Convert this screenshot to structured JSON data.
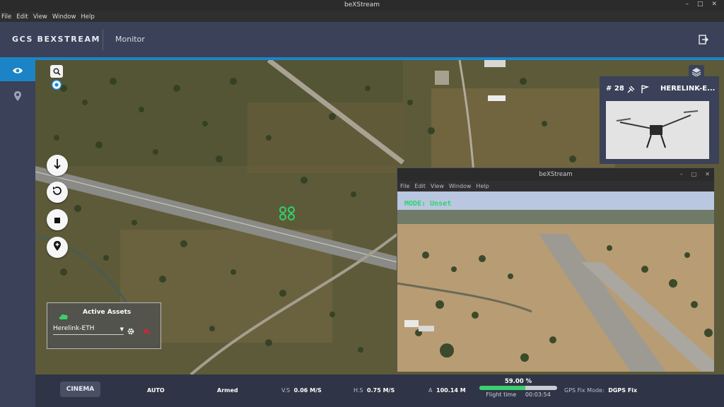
{
  "window": {
    "title": "beXStream",
    "controls": [
      "–",
      "□",
      "✕"
    ],
    "menu": [
      "File",
      "Edit",
      "View",
      "Window",
      "Help"
    ]
  },
  "header": {
    "brand": "GCS BEXSTREAM",
    "section": "Monitor",
    "logout_icon": "logout-icon"
  },
  "sidebar": {
    "items": [
      {
        "icon": "eye-icon",
        "active": true
      },
      {
        "icon": "location-pin-icon",
        "active": false
      }
    ]
  },
  "map_controls": {
    "small": [
      "search-icon",
      "target-icon"
    ],
    "round": [
      "arrow-down-icon",
      "rotate-icon",
      "stop-icon",
      "add-waypoint-icon"
    ],
    "layers_icon": "layers-icon"
  },
  "active_assets": {
    "title": "Active Assets",
    "selected": "Herelink-ETH"
  },
  "asset_card": {
    "number": "# 28",
    "name": "HERELINK-E..."
  },
  "video_window": {
    "title": "beXStream",
    "controls": [
      "–",
      "□",
      "✕"
    ],
    "menu": [
      "File",
      "Edit",
      "View",
      "Window",
      "Help"
    ],
    "mode": "MODE: Unset"
  },
  "status": {
    "cinema": "CINEMA",
    "flight_mode": "AUTO",
    "armed": "Armed",
    "vs_label": "V.S",
    "vs_value": "0.06 M/S",
    "hs_label": "H.S",
    "hs_value": "0.75 M/S",
    "alt_label": "A",
    "alt_value": "100.14 M",
    "battery_text": "59.00 %",
    "battery_fraction": 0.59,
    "flight_time_label": "Flight time",
    "flight_time_value": "00:03:54",
    "gps_label": "GPS Fix Mode:",
    "gps_value": "DGPS Fix"
  },
  "colors": {
    "header": "#3a4158",
    "accent": "#1c84c6",
    "battery": "#3ccf6e",
    "mode_text": "#2fd36b"
  }
}
